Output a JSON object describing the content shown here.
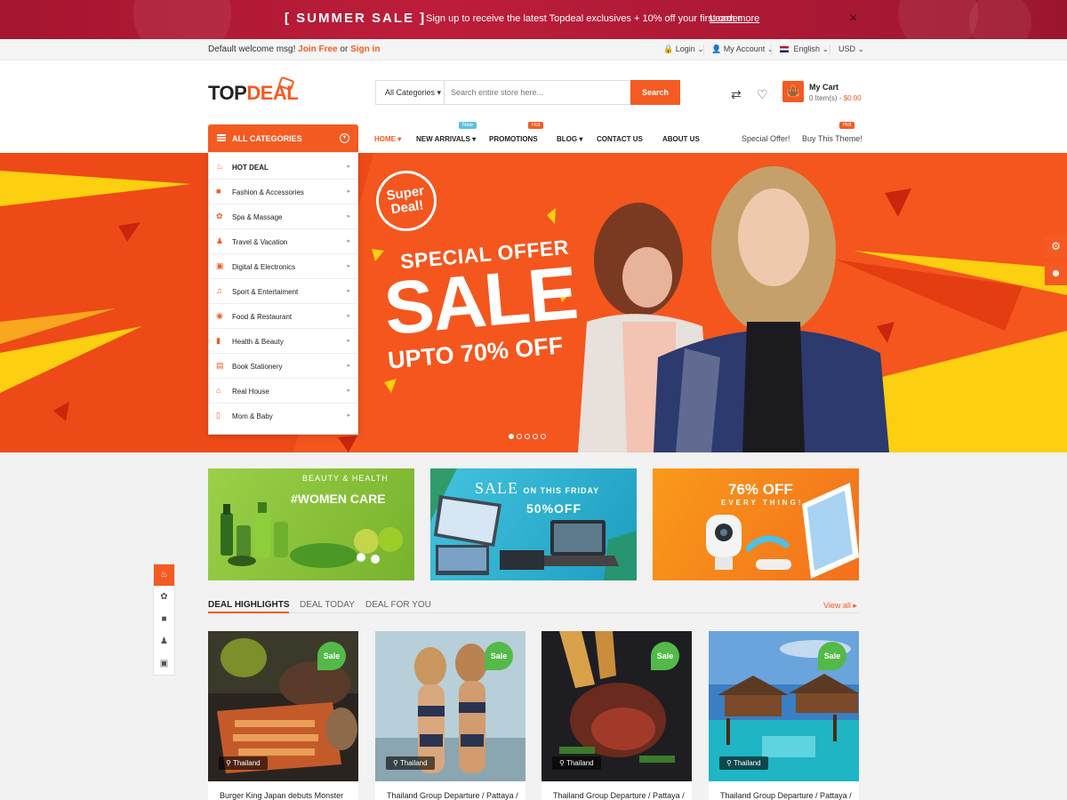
{
  "promo": {
    "title": "[ SUMMER SALE ]",
    "message": "Sign up to receive the latest Topdeal exclusives + 10% off your first order",
    "link": "Learn more",
    "close": "×"
  },
  "account_bar": {
    "welcome": "Default welcome msg!",
    "join": "Join Free",
    "or": "or",
    "signin": "Sign in",
    "login": "Login",
    "my_account": "My Account",
    "language": "English",
    "currency": "USD"
  },
  "header": {
    "logo_top": "TOP",
    "logo_deal": "DEAL",
    "search_category": "All Categories",
    "search_placeholder": "Search entire store here...",
    "search_button": "Search",
    "cart_title": "My Cart",
    "cart_items": "0 Item(s) -",
    "cart_total": "$0.00"
  },
  "nav": {
    "all_categories": "ALL CATEGORIES",
    "items": [
      {
        "label": "HOME"
      },
      {
        "label": "NEW ARRIVALS"
      },
      {
        "label": "PROMOTIONS"
      },
      {
        "label": "BLOG"
      },
      {
        "label": "CONTACT US"
      },
      {
        "label": "ABOUT US"
      }
    ],
    "badge_new": "New",
    "badge_hot": "Hot",
    "special_offer": "Special Offer!",
    "buy_theme": "Buy This Theme!"
  },
  "categories": [
    {
      "label": "HOT DEAL",
      "icon": "fire-icon"
    },
    {
      "label": "Fashion & Accessories",
      "icon": "shirt-icon"
    },
    {
      "label": "Spa & Massage",
      "icon": "lotus-icon"
    },
    {
      "label": "Travel & Vacation",
      "icon": "walker-icon"
    },
    {
      "label": "Digital & Electronics",
      "icon": "laptop-icon"
    },
    {
      "label": "Sport & Entertaiment",
      "icon": "guitar-icon"
    },
    {
      "label": "Food & Restaurant",
      "icon": "burger-icon"
    },
    {
      "label": "Health & Beauty",
      "icon": "bottle-icon"
    },
    {
      "label": "Book Stationery",
      "icon": "book-icon"
    },
    {
      "label": "Real House",
      "icon": "house-icon"
    },
    {
      "label": "Mom & Baby",
      "icon": "baby-bottle-icon"
    }
  ],
  "hero": {
    "super_deal_1": "Super",
    "super_deal_2": "Deal!",
    "special_offer": "SPECIAL OFFER",
    "sale": "SALE",
    "upto": "UPTO 70% OFF",
    "slides_count": 5,
    "active_slide": 1
  },
  "banners": [
    {
      "line1": "BEAUTY & HEALTH",
      "line2": "#WOMEN CARE"
    },
    {
      "line1": "SALE",
      "line1b": "ON THIS FRIDAY",
      "line2": "50%OFF"
    },
    {
      "line1": "76% OFF",
      "line2": "EVERY THING!"
    }
  ],
  "tabs": [
    {
      "label": "DEAL HIGHLIGHTS",
      "active": true
    },
    {
      "label": "DEAL TODAY",
      "active": false
    },
    {
      "label": "DEAL FOR YOU",
      "active": false
    }
  ],
  "view_all": "View all",
  "deals": [
    {
      "badge": "Sale",
      "location": "Thailand",
      "title": "Burger King Japan debuts Monster"
    },
    {
      "badge": "Sale",
      "location": "Thailand",
      "title": "Thailand Group Departure / Pattaya /"
    },
    {
      "badge": "Sale",
      "location": "Thailand",
      "title": "Thailand Group Departure / Pattaya /"
    },
    {
      "badge": "Sale",
      "location": "Thailand",
      "title": "Thailand Group Departure / Pattaya /"
    }
  ],
  "colors": {
    "accent": "#f45b22",
    "promo_bg": "#a5152f",
    "sale_badge": "#53b948",
    "hero_yellow": "#fccf10"
  }
}
